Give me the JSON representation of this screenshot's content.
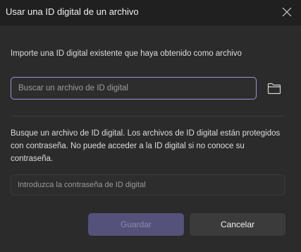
{
  "dialog": {
    "title": "Usar una ID digital de un archivo",
    "intro_text": "Importe una ID digital existente que haya obtenido como archivo",
    "search": {
      "placeholder": "Buscar un archivo de ID digital",
      "value": ""
    },
    "description": "Busque un archivo de ID digital. Los archivos de ID digital están protegidos con contraseña. No puede acceder a la ID digital si no conoce su contraseña.",
    "password": {
      "placeholder": "Introduzca la contraseña de ID digital",
      "value": ""
    },
    "buttons": {
      "save_label": "Guardar",
      "cancel_label": "Cancelar"
    },
    "icons": {
      "close": "close-icon",
      "folder": "folder-icon"
    }
  },
  "colors": {
    "accent": "#9a94d8",
    "background": "#2b2b2b",
    "titlebar": "#202020",
    "save_disabled": "#54517a"
  }
}
